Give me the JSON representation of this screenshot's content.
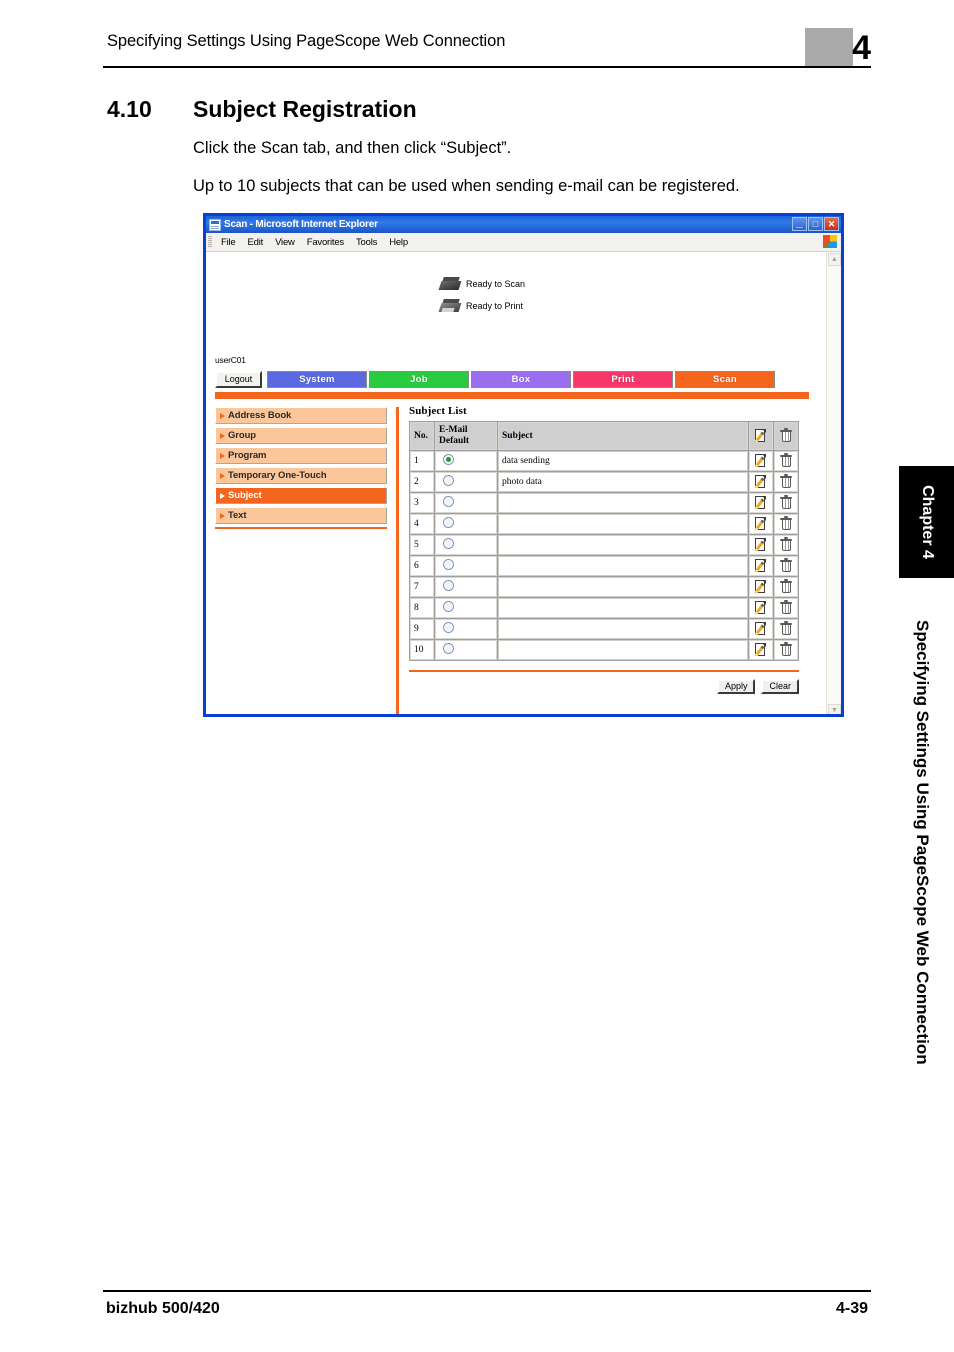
{
  "page": {
    "running_head": "Specifying Settings Using PageScope Web Connection",
    "chapter_number": "4",
    "section_number": "4.10",
    "section_title": "Subject Registration",
    "paragraph_1": "Click the Scan tab, and then click “Subject”.",
    "paragraph_2": "Up to 10 subjects that can be used when sending e-mail can be registered.",
    "side_tab": "Chapter 4",
    "side_vertical": "Specifying Settings Using PageScope Web Connection",
    "footer_left": "bizhub 500/420",
    "footer_right": "4-39"
  },
  "browser": {
    "title": "Scan - Microsoft Internet Explorer",
    "title_icon": "page-icon",
    "window_buttons": [
      {
        "name": "minimize",
        "glyph": "_"
      },
      {
        "name": "maximize",
        "glyph": "□"
      },
      {
        "name": "close",
        "glyph": "✕"
      }
    ],
    "menu": [
      "File",
      "Edit",
      "View",
      "Favorites",
      "Tools",
      "Help"
    ],
    "brand_icon": "windows-flag-icon",
    "scrollbar": {
      "up": "▲",
      "down": "▼"
    }
  },
  "webapp": {
    "status": [
      {
        "icon": "scanner-icon",
        "text": "Ready to Scan"
      },
      {
        "icon": "printer-icon",
        "text": "Ready to Print"
      }
    ],
    "user": "userC01",
    "logout_label": "Logout",
    "tabs": [
      {
        "label": "System",
        "color": "#5b6ae0"
      },
      {
        "label": "Job",
        "color": "#29cc3f"
      },
      {
        "label": "Box",
        "color": "#9b6ef0"
      },
      {
        "label": "Print",
        "color": "#f7376c"
      },
      {
        "label": "Scan",
        "color": "#f4651d"
      }
    ],
    "accent_color": "#f4651d",
    "sidebar": [
      {
        "label": "Address Book",
        "active": false
      },
      {
        "label": "Group",
        "active": false
      },
      {
        "label": "Program",
        "active": false
      },
      {
        "label": "Temporary One-Touch",
        "active": false
      },
      {
        "label": "Subject",
        "active": true
      },
      {
        "label": "Text",
        "active": false
      }
    ],
    "content": {
      "title": "Subject List",
      "columns": {
        "no": "No.",
        "default_l1": "E-Mail",
        "default_l2": "Default",
        "subject": "Subject",
        "edit_icon": "edit-icon",
        "delete_icon": "trash-icon"
      },
      "rows": [
        {
          "no": "1",
          "default": true,
          "subject": "data sending"
        },
        {
          "no": "2",
          "default": false,
          "subject": "photo data"
        },
        {
          "no": "3",
          "default": false,
          "subject": ""
        },
        {
          "no": "4",
          "default": false,
          "subject": ""
        },
        {
          "no": "5",
          "default": false,
          "subject": ""
        },
        {
          "no": "6",
          "default": false,
          "subject": ""
        },
        {
          "no": "7",
          "default": false,
          "subject": ""
        },
        {
          "no": "8",
          "default": false,
          "subject": ""
        },
        {
          "no": "9",
          "default": false,
          "subject": ""
        },
        {
          "no": "10",
          "default": false,
          "subject": ""
        }
      ],
      "buttons": [
        {
          "label": "Apply",
          "name": "apply-button"
        },
        {
          "label": "Clear",
          "name": "clear-button"
        }
      ]
    }
  }
}
